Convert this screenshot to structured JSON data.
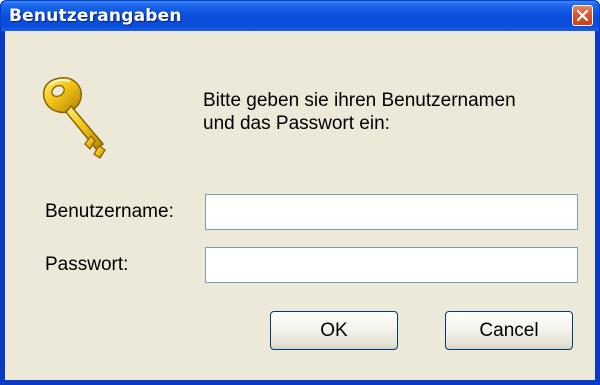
{
  "window": {
    "title": "Benutzerangaben"
  },
  "prompt": {
    "text": "Bitte geben sie ihren Benutzernamen\nund das Passwort ein:"
  },
  "form": {
    "username_label": "Benutzername:",
    "username_value": "",
    "password_label": "Passwort:",
    "password_value": ""
  },
  "buttons": {
    "ok_label": "OK",
    "cancel_label": "Cancel"
  },
  "icons": {
    "dialog_icon": "key-icon",
    "close": "close-icon"
  },
  "colors": {
    "titlebar": "#0a4cd8",
    "close_button": "#dd5a33",
    "client_background": "#ece9d8",
    "field_border": "#7f9db9",
    "button_border": "#003c74"
  }
}
